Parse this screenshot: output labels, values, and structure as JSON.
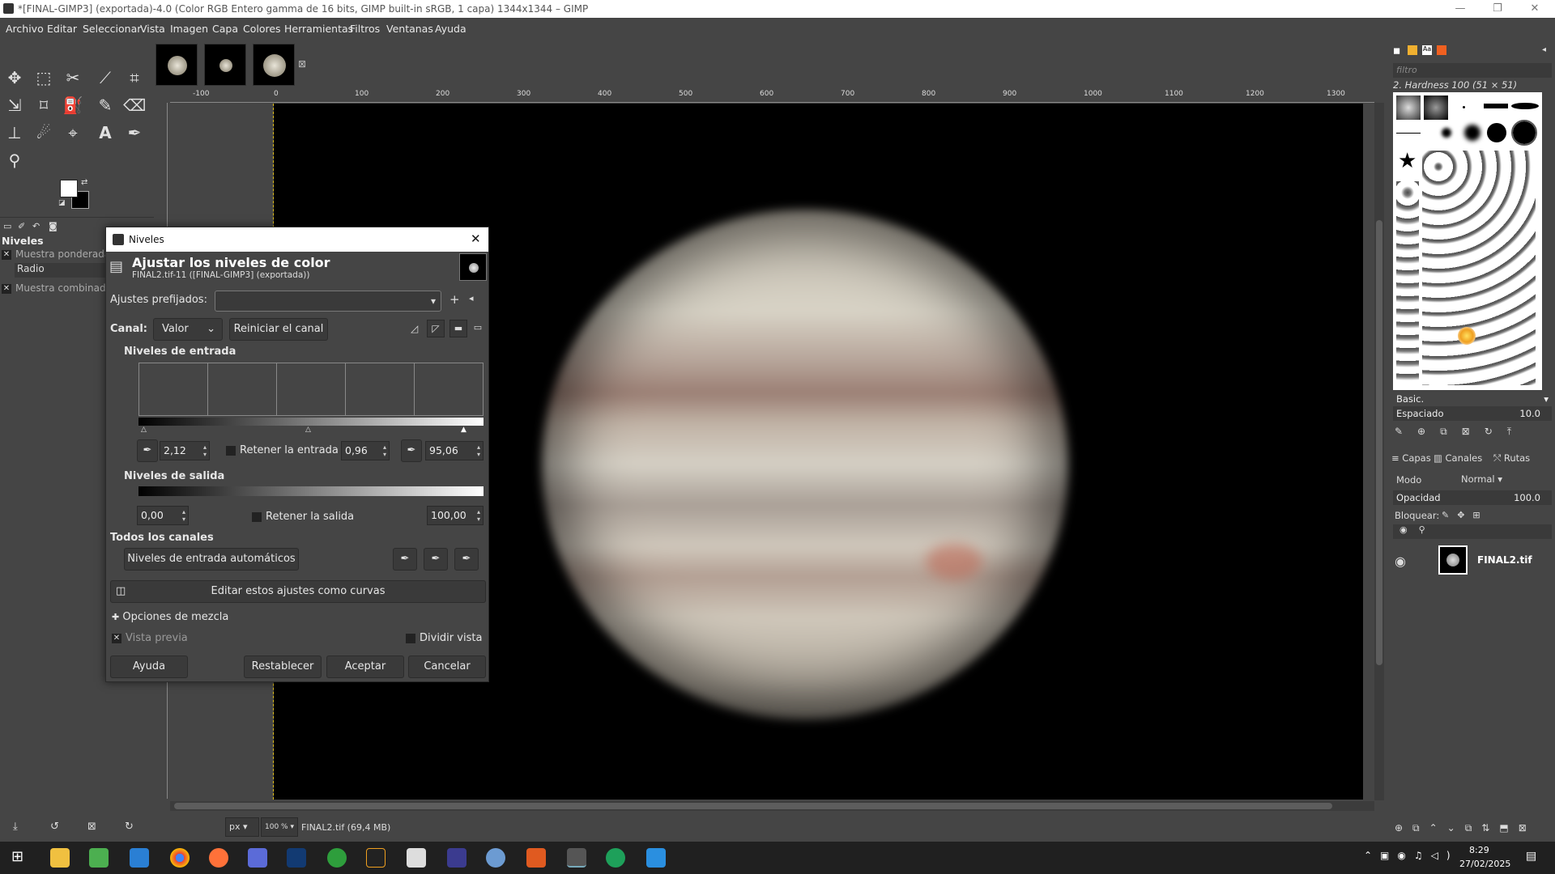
{
  "window": {
    "title": "*[FINAL-GIMP3] (exportada)-4.0 (Color RGB Entero gamma de 16 bits, GIMP built-in sRGB, 1 capa) 1344x1344 – GIMP",
    "min": "—",
    "max": "❐",
    "close": "✕"
  },
  "menu": [
    "Archivo",
    "Editar",
    "Seleccionar",
    "Vista",
    "Imagen",
    "Capa",
    "Colores",
    "Herramientas",
    "Filtros",
    "Ventanas",
    "Ayuda"
  ],
  "tool_options": {
    "title": "Niveles",
    "row1": "Muestra ponderada",
    "row2": "Radio",
    "row3": "Muestra combinada"
  },
  "ruler_marks": [
    "-100",
    "0",
    "100",
    "200",
    "300",
    "400",
    "500",
    "600",
    "700",
    "800",
    "900",
    "1000",
    "1100",
    "1200",
    "1300"
  ],
  "status": {
    "unit": "px",
    "zoom": "100 %",
    "info": "FINAL2.tif (69,4 MB)"
  },
  "dialog": {
    "window_title": "Niveles",
    "heading": "Ajustar los niveles de color",
    "subheading": "FINAL2.tif-11 ([FINAL-GIMP3] (exportada))",
    "presets_label": "Ajustes prefijados:",
    "channel_label": "Canal:",
    "channel_value": "Valor",
    "reset_channel": "Reiniciar el canal",
    "input_levels": "Niveles de entrada",
    "input_low": "2,12",
    "keep_input": "Retener la entrada",
    "gamma": "0,96",
    "input_high": "95,06",
    "output_levels": "Niveles de salida",
    "output_low": "0,00",
    "keep_output": "Retener la salida",
    "output_high": "100,00",
    "all_channels": "Todos los canales",
    "auto_levels": "Niveles de entrada automáticos",
    "edit_curves": "Editar estos ajustes como curvas",
    "blend_options": "Opciones de mezcla",
    "preview": "Vista previa",
    "split_view": "Dividir vista",
    "help": "Ayuda",
    "reset": "Restablecer",
    "ok": "Aceptar",
    "cancel": "Cancelar"
  },
  "dock": {
    "filter_placeholder": "filtro",
    "brush_name": "2. Hardness 100 (51 × 51)",
    "brush_tag": "Basic.",
    "spacing_label": "Espaciado",
    "spacing_value": "10.0",
    "tabs": [
      "Capas",
      "Canales",
      "Rutas"
    ],
    "mode_label": "Modo",
    "mode_value": "Normal",
    "opacity_label": "Opacidad",
    "opacity_value": "100.0",
    "lock_label": "Bloquear:",
    "layer_name": "FINAL2.tif"
  },
  "taskbar": {
    "time": "8:29",
    "date": "27/02/2025"
  }
}
